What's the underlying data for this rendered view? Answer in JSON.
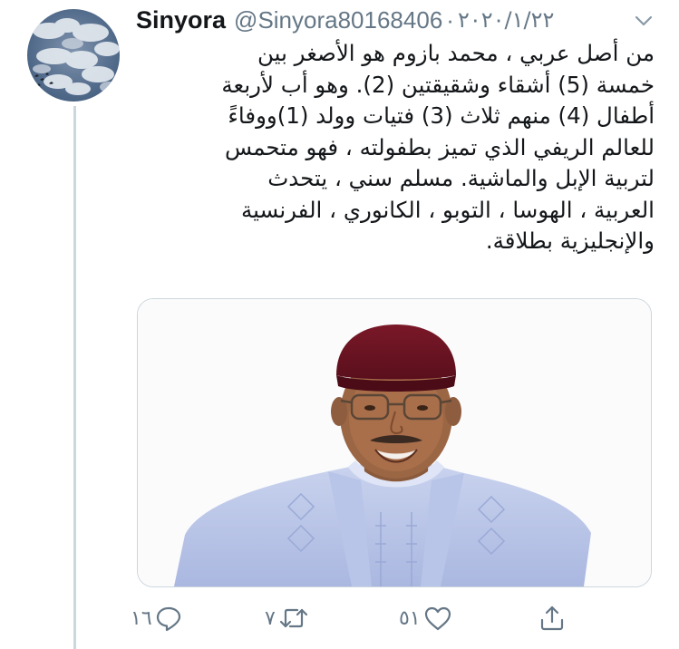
{
  "tweet": {
    "author": {
      "display_name": "Sinyora",
      "handle": "@Sinyora80168406",
      "avatar_icon": "cloudy-sky-avatar"
    },
    "separator": "·",
    "date": "٢٠٢٠/١/٢٢",
    "menu_icon": "chevron-down-icon",
    "text_lines": [
      "من أصل عربي ، محمد بازوم هو الأصغر بين",
      "خمسة (5) أشقاء وشقيقتين (2).  وهو أب لأربعة",
      "أطفال (4) منهم ثلاث (3) فتيات وولد (1)ووفاءً",
      "للعالم الريفي الذي تميز بطفولته ، فهو متحمس",
      "لتربية الإبل والماشية.  مسلم سني ، يتحدث",
      "العربية ، الهوسا ، التوبو ، الكانوري ، الفرنسية",
      "والإنجليزية بطلاقة."
    ],
    "media": {
      "type": "photo",
      "description_icon": "portrait-photo"
    },
    "actions": {
      "reply": {
        "icon": "reply-icon",
        "count": "١٦"
      },
      "retweet": {
        "icon": "retweet-icon",
        "count": "٧"
      },
      "like": {
        "icon": "heart-icon",
        "count": "٥١"
      },
      "share": {
        "icon": "share-icon",
        "count": ""
      }
    }
  },
  "colors": {
    "text": "#14171a",
    "secondary": "#657786",
    "border": "#ccd6dd",
    "background": "#ffffff",
    "hat": "#6e1322"
  }
}
